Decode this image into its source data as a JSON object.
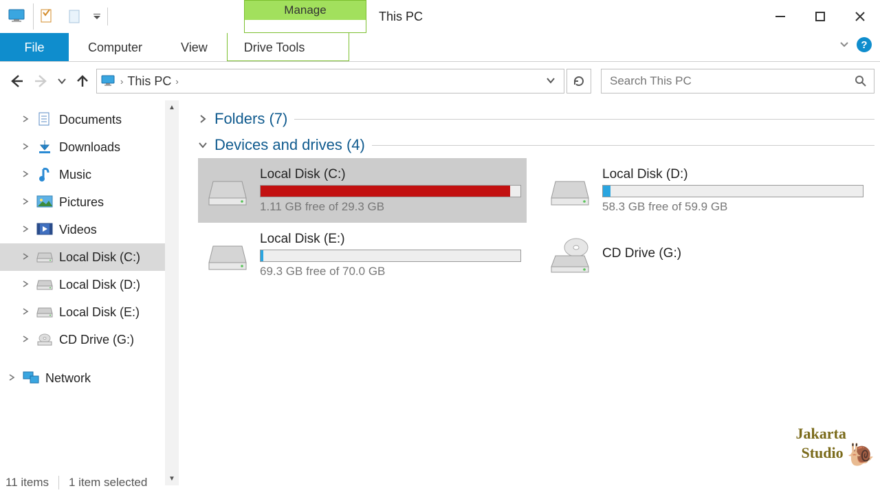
{
  "window": {
    "title": "This PC",
    "ribbon_context": "Manage",
    "drive_tools": "Drive Tools"
  },
  "tabs": {
    "file": "File",
    "computer": "Computer",
    "view": "View"
  },
  "address": {
    "crumb": "This PC"
  },
  "search": {
    "placeholder": "Search This PC"
  },
  "tree": [
    {
      "label": "Documents",
      "icon": "doc"
    },
    {
      "label": "Downloads",
      "icon": "download"
    },
    {
      "label": "Music",
      "icon": "music"
    },
    {
      "label": "Pictures",
      "icon": "pictures"
    },
    {
      "label": "Videos",
      "icon": "videos"
    },
    {
      "label": "Local Disk (C:)",
      "icon": "drive"
    },
    {
      "label": "Local Disk (D:)",
      "icon": "drive"
    },
    {
      "label": "Local Disk (E:)",
      "icon": "drive"
    },
    {
      "label": "CD Drive (G:)",
      "icon": "cd"
    },
    {
      "label": "Network",
      "icon": "network"
    }
  ],
  "groups": {
    "folders": "Folders (7)",
    "drives": "Devices and drives (4)"
  },
  "drives": [
    {
      "name": "Local Disk (C:)",
      "free": "1.11 GB free of 29.3 GB",
      "pct": 96,
      "critical": true,
      "selected": true,
      "type": "hdd"
    },
    {
      "name": "Local Disk (D:)",
      "free": "58.3 GB free of 59.9 GB",
      "pct": 3,
      "critical": false,
      "selected": false,
      "type": "hdd"
    },
    {
      "name": "Local Disk (E:)",
      "free": "69.3 GB free of 70.0 GB",
      "pct": 1,
      "critical": false,
      "selected": false,
      "type": "hdd"
    },
    {
      "name": "CD Drive (G:)",
      "free": "",
      "pct": null,
      "critical": false,
      "selected": false,
      "type": "cd"
    }
  ],
  "statusbar": {
    "items": "11 items",
    "selection": "1 item selected"
  },
  "watermark": {
    "line1": "Jakarta",
    "line2": "Studio"
  }
}
